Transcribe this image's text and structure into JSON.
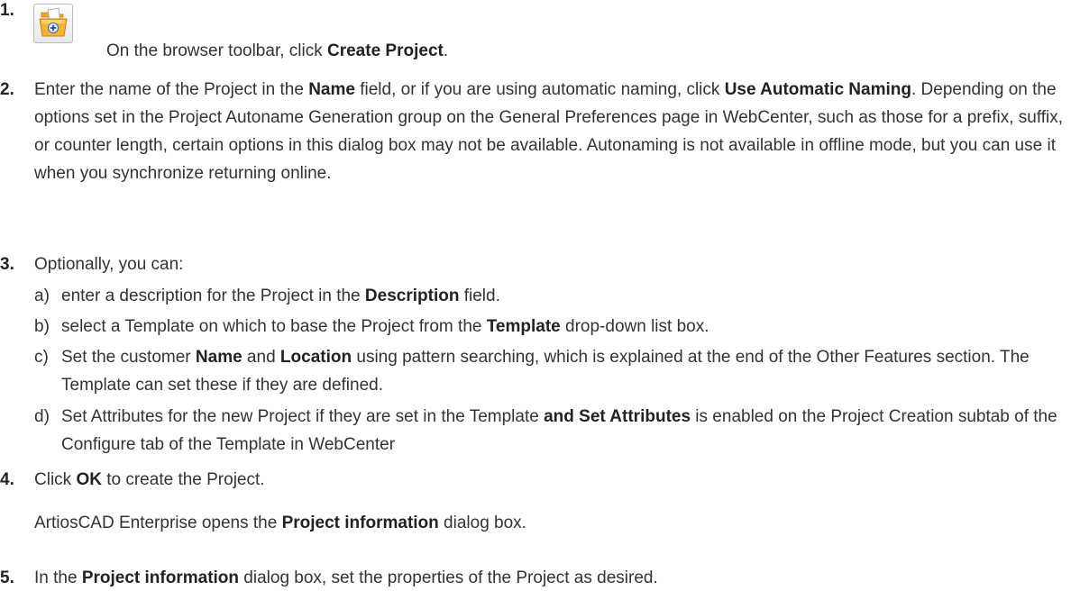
{
  "steps": [
    {
      "number": "1.",
      "icon": "create-project-icon",
      "parts": [
        "On the browser toolbar, click ",
        "Create Project",
        "."
      ]
    },
    {
      "number": "2.",
      "parts": [
        "Enter the name of the Project in the ",
        "Name",
        " field, or if you are using automatic naming, click ",
        "Use Automatic Naming",
        ". Depending on the options set in the Project Autoname Generation group on the General Preferences page in WebCenter, such as those for a prefix, suffix, or counter length, certain options in this dialog box may not be available. Autonaming is not available in offline mode, but you can use it when you synchronize returning online."
      ]
    },
    {
      "number": "3.",
      "text": "Optionally, you can:",
      "substeps": [
        {
          "label": "a)",
          "parts": [
            "enter a description for the Project in the ",
            "Description",
            " field."
          ]
        },
        {
          "label": "b)",
          "parts": [
            "select a Template on which to base the Project from the ",
            "Template",
            " drop-down list box."
          ]
        },
        {
          "label": "c)",
          "parts": [
            "Set the customer ",
            "Name",
            " and ",
            "Location",
            " using pattern searching, which is explained at the end of the Other Features section. The Template can set these if they are defined."
          ]
        },
        {
          "label": "d)",
          "parts": [
            "Set Attributes for the new Project if they are set in the Template ",
            "and Set Attributes",
            " is enabled on the Project Creation subtab of the Configure tab of the Template in WebCenter"
          ]
        }
      ]
    },
    {
      "number": "4.",
      "parts": [
        "Click ",
        "OK",
        " to create the Project."
      ],
      "result": [
        "ArtiosCAD Enterprise opens the ",
        "Project information",
        " dialog box."
      ]
    },
    {
      "number": "5.",
      "parts": [
        "In the ",
        "Project information",
        " dialog box, set the properties of the Project as desired."
      ]
    }
  ]
}
